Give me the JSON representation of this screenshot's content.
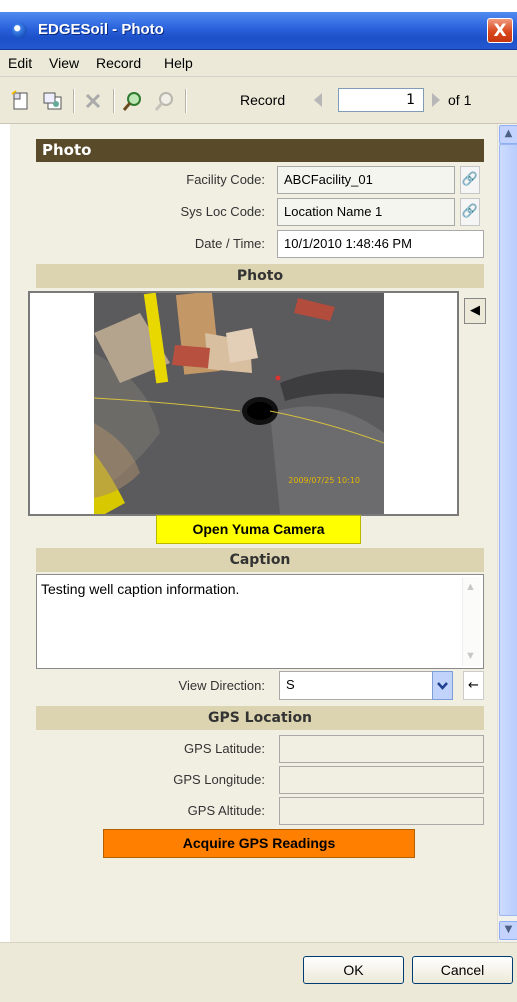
{
  "window": {
    "title": "EDGESoil - Photo",
    "close_glyph": "X"
  },
  "menu": [
    "Edit",
    "View",
    "Record",
    "Help"
  ],
  "toolbar": {
    "icons": [
      "new-record-icon",
      "copy-record-icon",
      "delete-icon",
      "find-icon",
      "find-next-icon"
    ],
    "record_label": "Record",
    "record_value": "1",
    "of_label": "of 1"
  },
  "photo_section": {
    "header": "Photo",
    "facility_label": "Facility Code:",
    "facility_value": "ABCFacility_01",
    "sysloc_label": "Sys Loc Code:",
    "sysloc_value": "Location Name 1",
    "datetime_label": "Date / Time:",
    "datetime_value": "10/1/2010 1:48:46 PM",
    "photo_subheader": "Photo",
    "photo_timestamp": "2009/07/25 10:10",
    "open_camera_label": "Open Yuma Camera"
  },
  "caption_section": {
    "subheader": "Caption",
    "caption_text": "Testing well caption information.",
    "view_direction_label": "View Direction:",
    "view_direction_value": "S",
    "back_glyph": "←"
  },
  "gps_section": {
    "subheader": "GPS Location",
    "latitude_label": "GPS Latitude:",
    "longitude_label": "GPS Longitude:",
    "altitude_label": "GPS Altitude:",
    "latitude_value": "",
    "longitude_value": "",
    "altitude_value": "",
    "acquire_label": "Acquire GPS Readings"
  },
  "footer": {
    "ok_label": "OK",
    "cancel_label": "Cancel"
  },
  "colors": {
    "section_header": "#594a2a",
    "subheader": "#dcd4b0",
    "camera_button": "#ffff00",
    "gps_button": "#ff7f00"
  }
}
